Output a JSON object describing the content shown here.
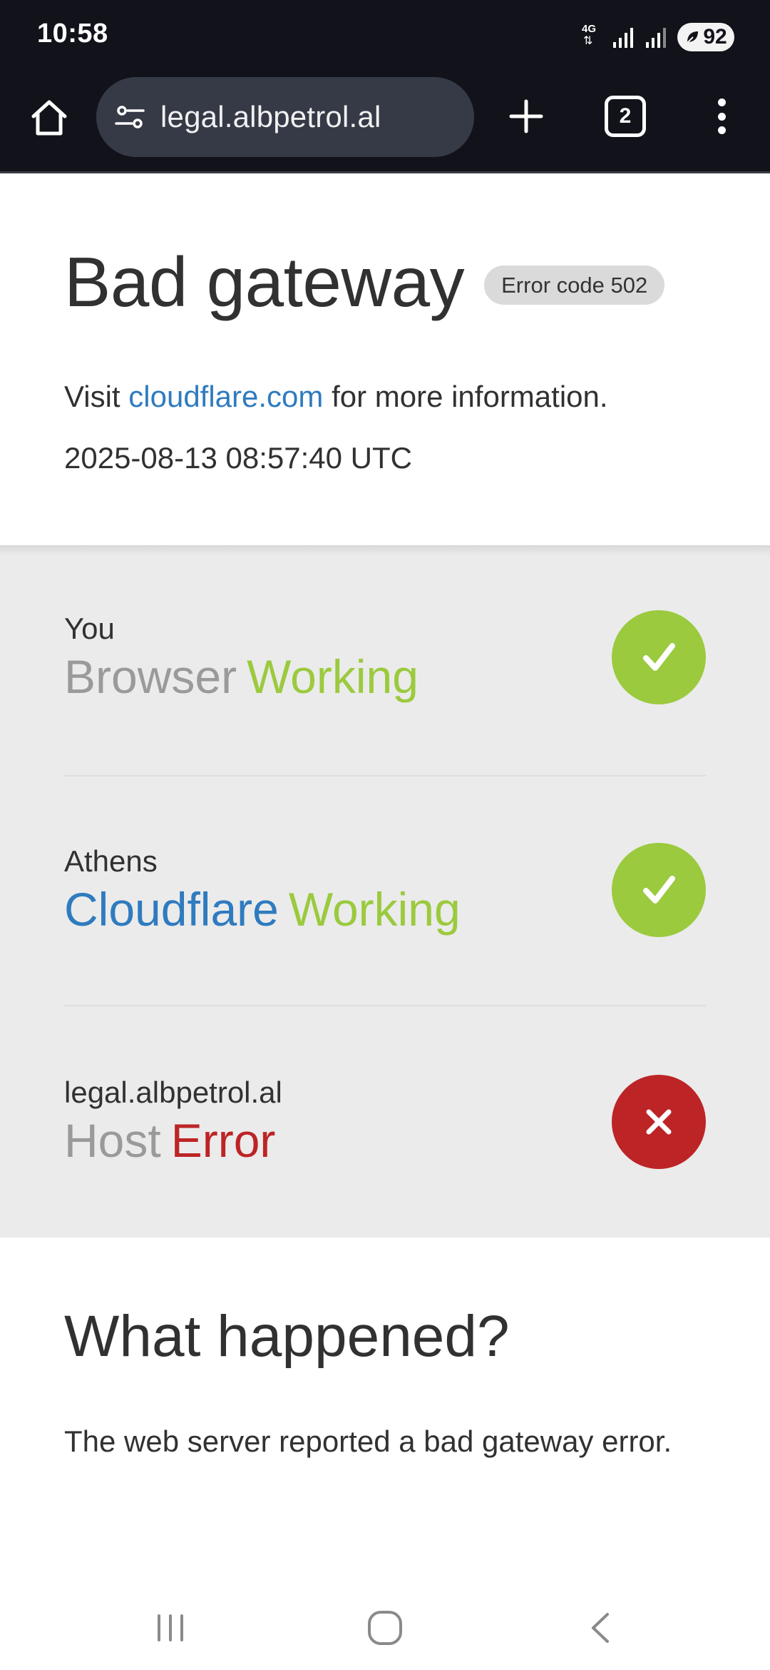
{
  "status_bar": {
    "time": "10:58",
    "network": "4G",
    "battery": "92"
  },
  "browser": {
    "url": "legal.albpetrol.al",
    "tab_count": "2"
  },
  "header": {
    "title": "Bad gateway",
    "error_code": "Error code 502",
    "visit_prefix": "Visit",
    "visit_link": "cloudflare.com",
    "visit_suffix": "for more information.",
    "timestamp": "2025-08-13 08:57:40 UTC"
  },
  "nodes": [
    {
      "location": "You",
      "name": "Browser",
      "status": "Working",
      "state": "ok",
      "name_color": "#9a9a9a",
      "status_color": "#9bca3e"
    },
    {
      "location": "Athens",
      "name": "Cloudflare",
      "status": "Working",
      "state": "ok",
      "name_color": "#2f7bbf",
      "status_color": "#9bca3e"
    },
    {
      "location": "legal.albpetrol.al",
      "name": "Host",
      "status": "Error",
      "state": "error",
      "name_color": "#9a9a9a",
      "status_color": "#bd2426"
    }
  ],
  "what_happened": {
    "title": "What happened?",
    "body": "The web server reported a bad gateway error."
  },
  "icons": {
    "home": "home-icon",
    "site_info": "tune-icon",
    "new_tab": "plus-icon",
    "menu": "more-vert-icon",
    "ok": "check-icon",
    "error": "close-icon",
    "nav_recents": "recents-icon",
    "nav_home": "home-circle-icon",
    "nav_back": "back-icon"
  }
}
